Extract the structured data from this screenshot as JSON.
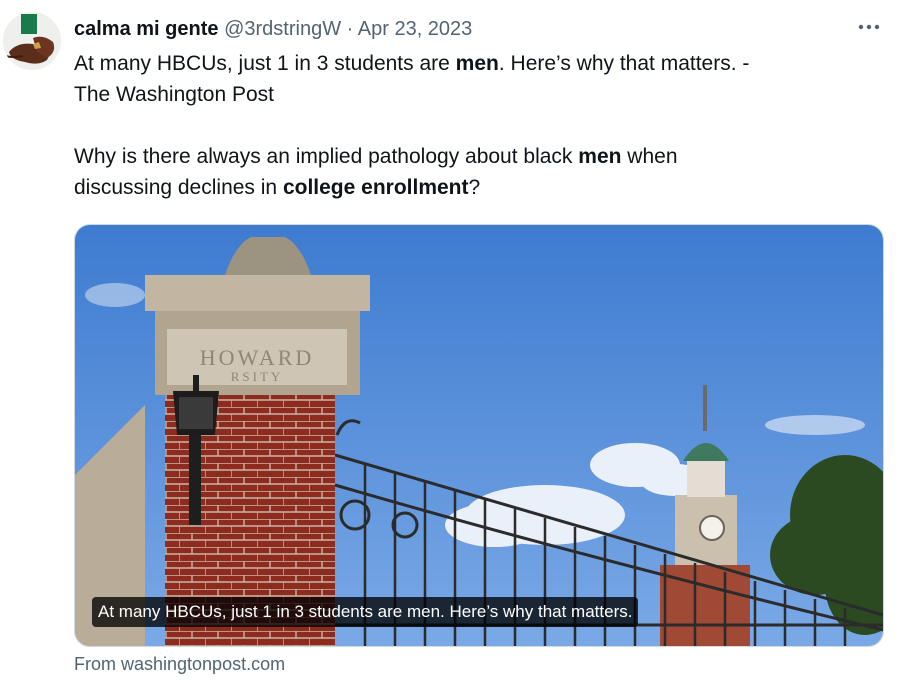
{
  "tweet": {
    "display_name": "calma mi gente",
    "handle": "@3rdstringW",
    "separator": "·",
    "date": "Apr 23, 2023",
    "more_icon": "more-horizontal-icon",
    "line1_a": "At many HBCUs, just 1 in 3 students are ",
    "line1_b": "men",
    "line1_c": ". Here’s why that matters. -",
    "line2": "The Washington Post",
    "line3_a": "Why is there always an implied pathology about black ",
    "line3_b": "men",
    "line3_c": " when",
    "line4_a": "discussing declines in ",
    "line4_b": "college enrollment",
    "line4_c": "?"
  },
  "card": {
    "caption": "At many HBCUs, just 1 in 3 students are men. Here’s why that matters.",
    "sign_top": "HOWARD",
    "sign_bottom": "RSITY",
    "source": "From washingtonpost.com"
  },
  "colors": {
    "sky": "#4a86d6",
    "brick": "#8c2a1e",
    "stone": "#b8ad9c",
    "text_muted": "#536471"
  }
}
